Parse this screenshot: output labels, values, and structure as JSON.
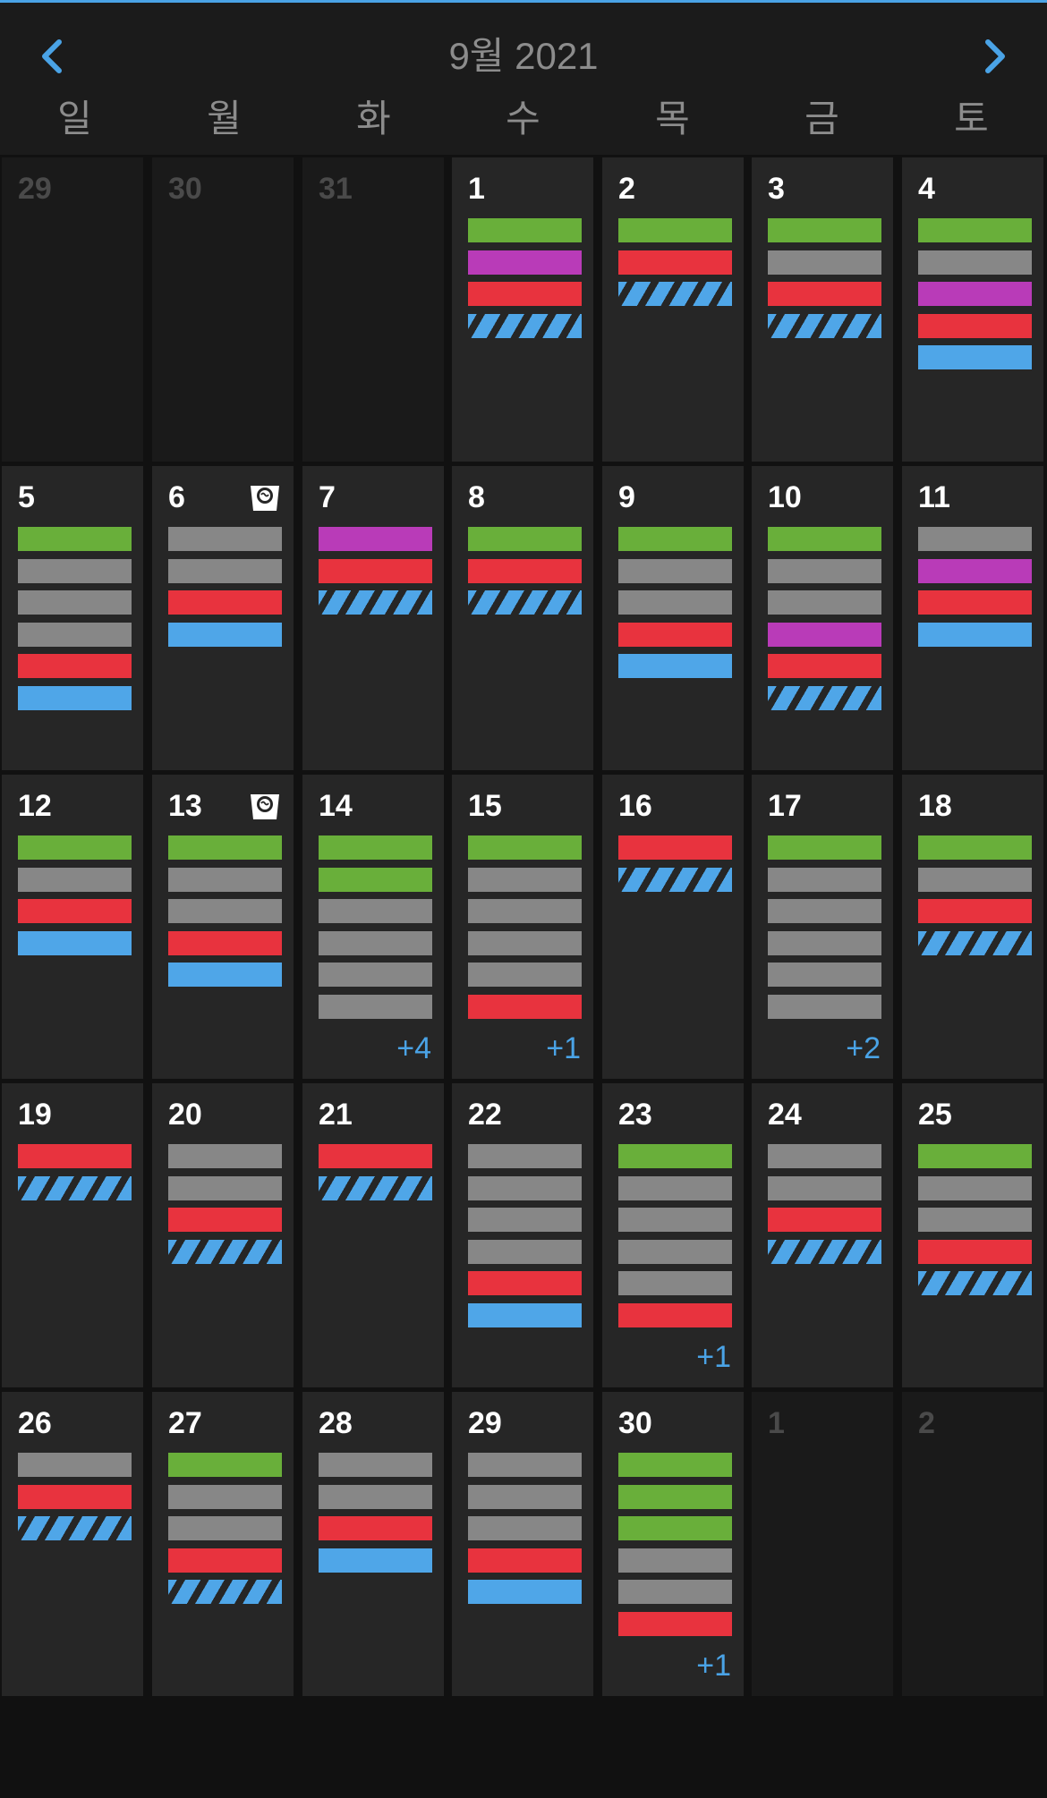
{
  "header": {
    "title": "9월 2021",
    "prev_icon": "chevron-left-icon",
    "next_icon": "chevron-right-icon"
  },
  "weekdays": [
    "일",
    "월",
    "화",
    "수",
    "목",
    "금",
    "토"
  ],
  "colors": {
    "accent": "#4aa3e6",
    "green": "#69af3a",
    "gray": "#878787",
    "red": "#e8333e",
    "purple": "#b93bb8",
    "blue": "#4fa6e8",
    "cell": "#262626",
    "cell_other": "#1a1a1a",
    "background": "#111111"
  },
  "weeks": [
    [
      {
        "day": "29",
        "other": true,
        "bars": []
      },
      {
        "day": "30",
        "other": true,
        "bars": []
      },
      {
        "day": "31",
        "other": true,
        "bars": []
      },
      {
        "day": "1",
        "bars": [
          "green",
          "purple",
          "red",
          "striped"
        ]
      },
      {
        "day": "2",
        "bars": [
          "green",
          "red",
          "striped"
        ]
      },
      {
        "day": "3",
        "bars": [
          "green",
          "gray",
          "red",
          "striped"
        ]
      },
      {
        "day": "4",
        "bars": [
          "green",
          "gray",
          "purple",
          "red",
          "blue"
        ]
      }
    ],
    [
      {
        "day": "5",
        "bars": [
          "green",
          "gray",
          "gray",
          "gray",
          "red",
          "blue"
        ]
      },
      {
        "day": "6",
        "icon": "laundry-basket-icon",
        "bars": [
          "gray",
          "gray",
          "red",
          "blue"
        ]
      },
      {
        "day": "7",
        "bars": [
          "purple",
          "red",
          "striped"
        ]
      },
      {
        "day": "8",
        "bars": [
          "green",
          "red",
          "striped"
        ]
      },
      {
        "day": "9",
        "bars": [
          "green",
          "gray",
          "gray",
          "red",
          "blue"
        ]
      },
      {
        "day": "10",
        "bars": [
          "green",
          "gray",
          "gray",
          "purple",
          "red",
          "striped"
        ]
      },
      {
        "day": "11",
        "bars": [
          "gray",
          "purple",
          "red",
          "blue"
        ]
      }
    ],
    [
      {
        "day": "12",
        "bars": [
          "green",
          "gray",
          "red",
          "blue"
        ]
      },
      {
        "day": "13",
        "icon": "laundry-basket-icon",
        "bars": [
          "green",
          "gray",
          "gray",
          "red",
          "blue"
        ]
      },
      {
        "day": "14",
        "bars": [
          "green",
          "green",
          "gray",
          "gray",
          "gray",
          "gray"
        ],
        "more": "+4"
      },
      {
        "day": "15",
        "bars": [
          "green",
          "gray",
          "gray",
          "gray",
          "gray",
          "red"
        ],
        "more": "+1"
      },
      {
        "day": "16",
        "bars": [
          "red",
          "striped"
        ]
      },
      {
        "day": "17",
        "bars": [
          "green",
          "gray",
          "gray",
          "gray",
          "gray",
          "gray"
        ],
        "more": "+2"
      },
      {
        "day": "18",
        "bars": [
          "green",
          "gray",
          "red",
          "striped"
        ]
      }
    ],
    [
      {
        "day": "19",
        "bars": [
          "red",
          "striped"
        ]
      },
      {
        "day": "20",
        "bars": [
          "gray",
          "gray",
          "red",
          "striped"
        ]
      },
      {
        "day": "21",
        "bars": [
          "red",
          "striped"
        ]
      },
      {
        "day": "22",
        "bars": [
          "gray",
          "gray",
          "gray",
          "gray",
          "red",
          "blue"
        ]
      },
      {
        "day": "23",
        "bars": [
          "green",
          "gray",
          "gray",
          "gray",
          "gray",
          "red"
        ],
        "more": "+1"
      },
      {
        "day": "24",
        "bars": [
          "gray",
          "gray",
          "red",
          "striped"
        ]
      },
      {
        "day": "25",
        "bars": [
          "green",
          "gray",
          "gray",
          "red",
          "striped"
        ]
      }
    ],
    [
      {
        "day": "26",
        "bars": [
          "gray",
          "red",
          "striped"
        ]
      },
      {
        "day": "27",
        "bars": [
          "green",
          "gray",
          "gray",
          "red",
          "striped"
        ]
      },
      {
        "day": "28",
        "bars": [
          "gray",
          "gray",
          "red",
          "blue"
        ]
      },
      {
        "day": "29",
        "bars": [
          "gray",
          "gray",
          "gray",
          "red",
          "blue"
        ]
      },
      {
        "day": "30",
        "bars": [
          "green",
          "green",
          "green",
          "gray",
          "gray",
          "red"
        ],
        "more": "+1"
      },
      {
        "day": "1",
        "other": true,
        "bars": []
      },
      {
        "day": "2",
        "other": true,
        "bars": []
      }
    ]
  ]
}
